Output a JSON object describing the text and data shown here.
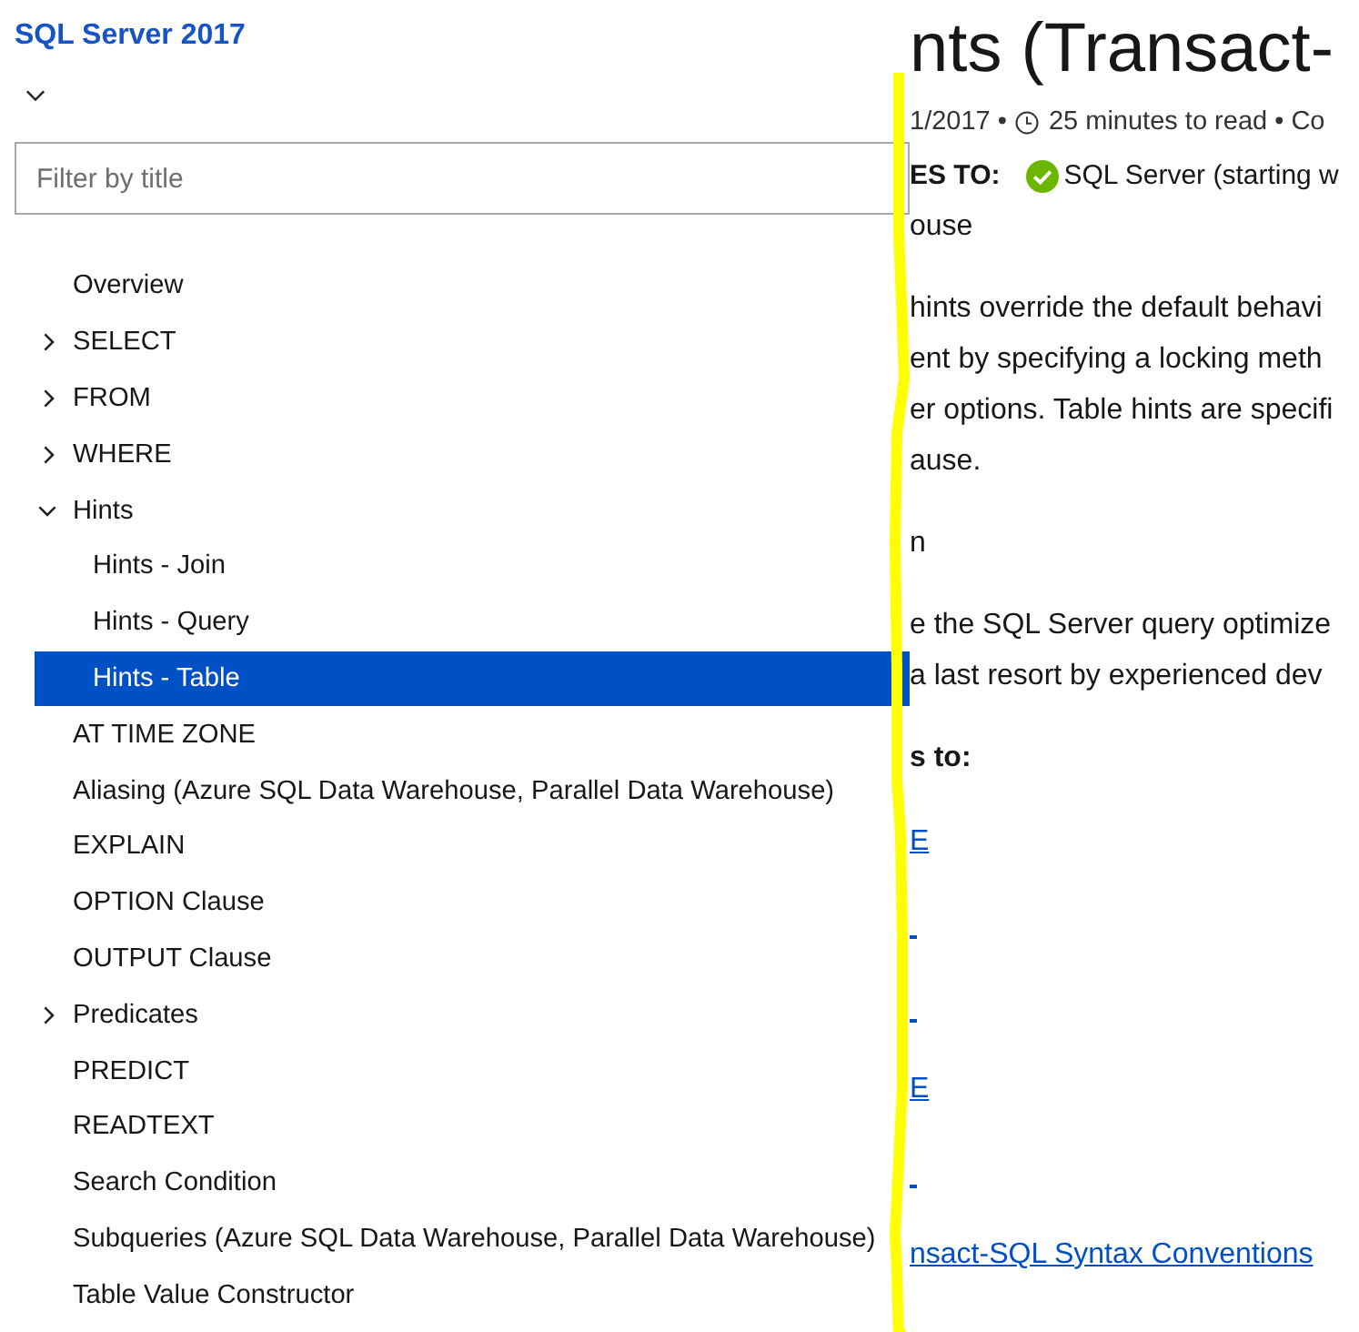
{
  "toc": {
    "title": "SQL Server 2017",
    "filter": {
      "placeholder": "Filter by title"
    },
    "items": [
      {
        "kind": "leaf",
        "label": "Overview",
        "selected": false
      },
      {
        "kind": "folder",
        "label": "SELECT",
        "expanded": false,
        "selected": false
      },
      {
        "kind": "folder",
        "label": "FROM",
        "expanded": false,
        "selected": false
      },
      {
        "kind": "folder",
        "label": "WHERE",
        "expanded": false,
        "selected": false
      },
      {
        "kind": "folder",
        "label": "Hints",
        "expanded": true,
        "selected": false,
        "children": [
          {
            "label": "Hints - Join",
            "selected": false
          },
          {
            "label": "Hints - Query",
            "selected": false
          },
          {
            "label": "Hints - Table",
            "selected": true
          }
        ]
      },
      {
        "kind": "leaf",
        "label": "AT TIME ZONE",
        "selected": false
      },
      {
        "kind": "leaf",
        "label": "Aliasing (Azure SQL Data Warehouse, Parallel Data Warehouse)",
        "selected": false
      },
      {
        "kind": "leaf",
        "label": "EXPLAIN",
        "selected": false
      },
      {
        "kind": "leaf",
        "label": "OPTION Clause",
        "selected": false
      },
      {
        "kind": "leaf",
        "label": "OUTPUT Clause",
        "selected": false
      },
      {
        "kind": "folder",
        "label": "Predicates",
        "expanded": false,
        "selected": false
      },
      {
        "kind": "leaf",
        "label": "PREDICT",
        "selected": false
      },
      {
        "kind": "leaf",
        "label": "READTEXT",
        "selected": false
      },
      {
        "kind": "leaf",
        "label": "Search Condition",
        "selected": false
      },
      {
        "kind": "leaf",
        "label": "Subqueries (Azure SQL Data Warehouse, Parallel Data Warehouse)",
        "selected": false
      },
      {
        "kind": "leaf",
        "label": "Table Value Constructor",
        "selected": false
      }
    ]
  },
  "article": {
    "title": "nts (Transact-",
    "meta_date": "1/2017 •",
    "meta_read": "25 minutes to read • Co",
    "applies_label": "ES TO:",
    "applies_product": "SQL Server (starting w",
    "applies_more": "ouse",
    "paragraph_lines": [
      "hints override the default behavi",
      "ent by specifying a locking meth",
      "er options. Table hints are specifi",
      "ause."
    ],
    "heading": "n",
    "caution_lines": [
      "e the SQL Server query optimize",
      "a last resort by experienced dev"
    ],
    "list_label": "s to:",
    "links": [
      {
        "kind": "text",
        "text": "E"
      },
      {
        "kind": "sliver"
      },
      {
        "kind": "sliver"
      },
      {
        "kind": "text",
        "text": "E"
      },
      {
        "kind": "sliver"
      },
      {
        "kind": "text",
        "text": "nsact-SQL Syntax Conventions"
      }
    ]
  },
  "annotation": {
    "kind": "stroke"
  }
}
